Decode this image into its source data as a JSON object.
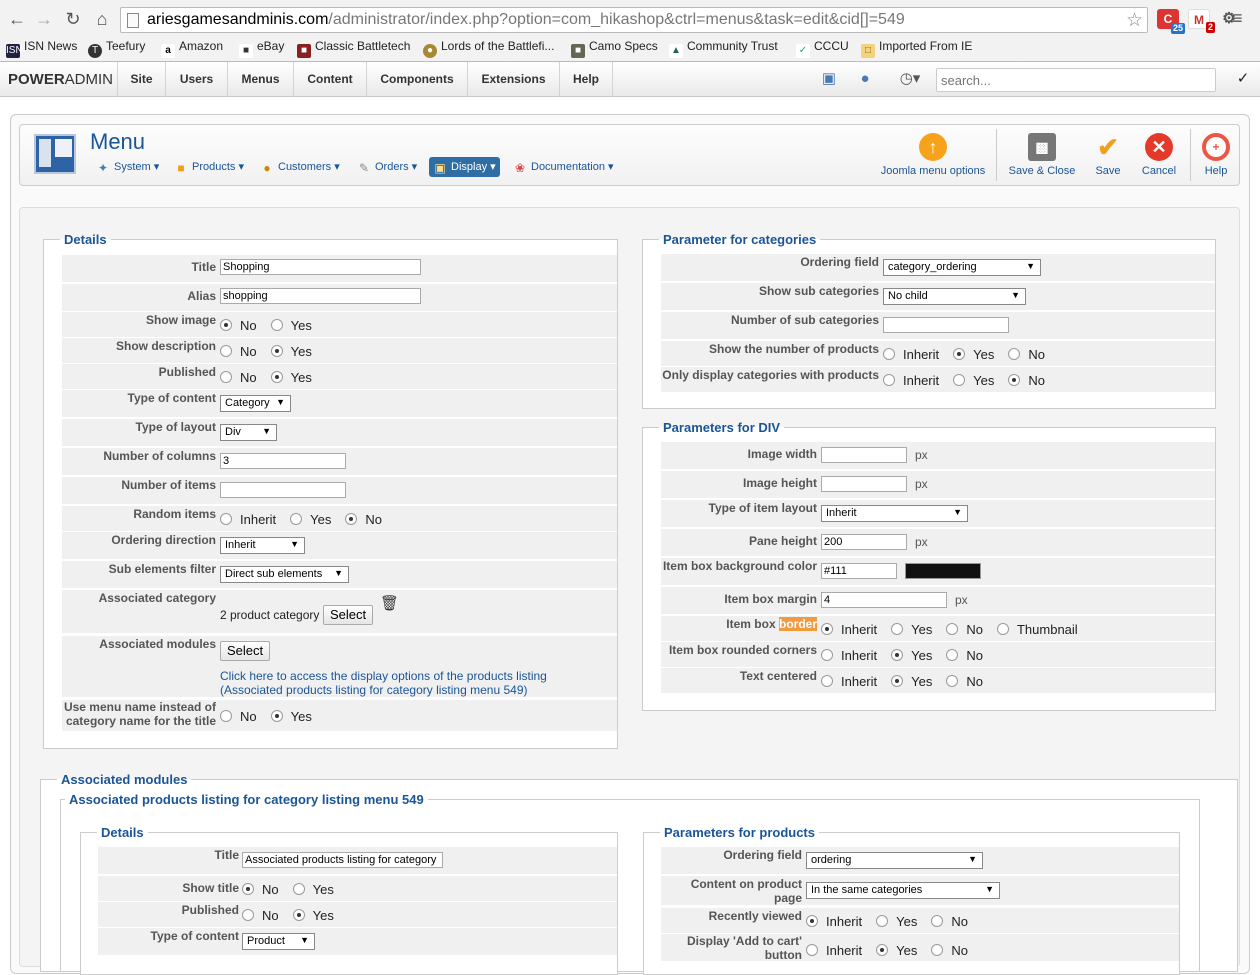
{
  "browser": {
    "url_host": "ariesgamesandminis.com",
    "url_rest": "/administrator/index.php?option=com_hikashop&ctrl=menus&task=edit&cid[]=549",
    "ext_badges": [
      "25",
      "2"
    ],
    "bookmarks": [
      "ISN News",
      "Teefury",
      "Amazon",
      "eBay",
      "Classic Battletech",
      "Lords of the Battlefi...",
      "Camo Specs",
      "Community Trust",
      "CCCU",
      "Imported From IE"
    ]
  },
  "adminbar": {
    "brand_a": "POWER",
    "brand_b": "ADMIN",
    "items": [
      "Site",
      "Users",
      "Menus",
      "Content",
      "Components",
      "Extensions",
      "Help"
    ],
    "search_placeholder": "search..."
  },
  "toolbar": {
    "title": "Menu",
    "submenu": [
      "System",
      "Products",
      "Customers",
      "Orders",
      "Display",
      "Documentation"
    ],
    "buttons": [
      "Joomla menu options",
      "Save & Close",
      "Save",
      "Cancel",
      "Help"
    ]
  },
  "details": {
    "legend": "Details",
    "title_label": "Title",
    "title_value": "Shopping",
    "alias_label": "Alias",
    "alias_value": "shopping",
    "show_image_label": "Show image",
    "show_desc_label": "Show description",
    "published_label": "Published",
    "type_content_label": "Type of content",
    "type_content_value": "Category",
    "type_layout_label": "Type of layout",
    "type_layout_value": "Div",
    "num_cols_label": "Number of columns",
    "num_cols_value": "3",
    "num_items_label": "Number of items",
    "random_label": "Random items",
    "ordering_dir_label": "Ordering direction",
    "ordering_dir_value": "Inherit",
    "sub_filter_label": "Sub elements filter",
    "sub_filter_value": "Direct sub elements",
    "assoc_cat_label": "Associated category",
    "assoc_cat_value": "2 product category",
    "select_label": "Select",
    "assoc_mod_label": "Associated modules",
    "link_line1": "Click here to access the display options of the products listing",
    "link_line2": "(Associated products listing for category listing menu 549)",
    "use_menu_name_label1": "Use menu name instead of",
    "use_menu_name_label2": "category name for the title"
  },
  "radio": {
    "no": "No",
    "yes": "Yes",
    "inherit": "Inherit",
    "thumbnail": "Thumbnail"
  },
  "categories": {
    "legend": "Parameter for categories",
    "ordering_label": "Ordering field",
    "ordering_value": "category_ordering",
    "show_sub_label": "Show sub categories",
    "show_sub_value": "No child",
    "num_sub_label": "Number of sub categories",
    "show_num_products_label": "Show the number of products",
    "only_display_label": "Only display categories with products"
  },
  "div": {
    "legend": "Parameters for DIV",
    "img_w_label": "Image width",
    "img_h_label": "Image height",
    "item_layout_label": "Type of item layout",
    "item_layout_value": "Inherit",
    "pane_h_label": "Pane height",
    "pane_h_value": "200",
    "bg_label": "Item box background color",
    "bg_value": "#111",
    "bg_swatch": "#111111",
    "margin_label": "Item box margin",
    "margin_value": "4",
    "border_label_a": "Item box ",
    "border_label_b": "border",
    "rounded_label": "Item box rounded corners",
    "centered_label": "Text centered",
    "px": "px"
  },
  "assoc": {
    "legend": "Associated modules",
    "inner_legend": "Associated products listing for category listing menu 549",
    "details_legend": "Details",
    "title_label": "Title",
    "title_value": "Associated products listing for category li",
    "show_title_label": "Show title",
    "published_label": "Published",
    "type_content_label": "Type of content",
    "type_content_value": "Product",
    "products_legend": "Parameters for products",
    "ordering_label": "Ordering field",
    "ordering_value": "ordering",
    "content_page_label1": "Content on product",
    "content_page_label2": "page",
    "content_page_value": "In the same categories",
    "recent_label": "Recently viewed",
    "add_cart_label1": "Display 'Add to cart'",
    "add_cart_label2": "button"
  }
}
